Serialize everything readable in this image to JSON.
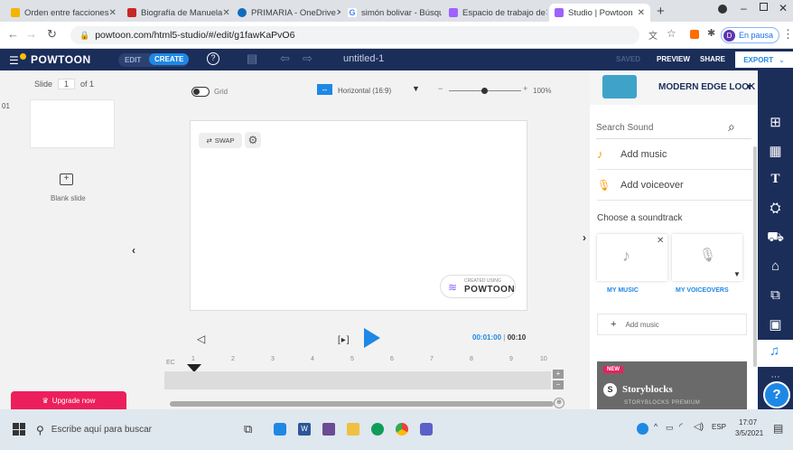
{
  "tabs": [
    {
      "label": "Orden entre facciones",
      "color": "#f4b400"
    },
    {
      "label": "Biografía de Manuela",
      "color": "#c62828"
    },
    {
      "label": "PRIMARIA - OneDrive",
      "color": "#0f6cbd"
    },
    {
      "label": "simón bolivar - Búsqu",
      "color": "#4285f4"
    },
    {
      "label": "Espacio de trabajo de",
      "color": "#a061ff"
    },
    {
      "label": "Studio | Powtoon",
      "color": "#a061ff"
    }
  ],
  "browser": {
    "url": "powtoon.com/html5-studio/#/edit/g1fawKaPvO6",
    "profile_initial": "D",
    "profile_status": "En pausa"
  },
  "toolbar": {
    "logo": "POWTOON",
    "edit": "EDIT",
    "create": "CREATE",
    "doc_title": "untitled-1",
    "saved": "SAVED",
    "preview": "PREVIEW",
    "share": "SHARE",
    "export": "EXPORT"
  },
  "slides": {
    "label": "Slide",
    "current": "1",
    "of": "of 1",
    "number": "01",
    "blank": "Blank slide"
  },
  "canvas": {
    "grid": "Grid",
    "orientation": "Horizontal (16:9)",
    "zoom": "100%",
    "swap": "SWAP",
    "watermark_small": "CREATED USING",
    "watermark": "POWTOON"
  },
  "timeline": {
    "time_current": "00:01:00",
    "time_total": "00:10",
    "ruler_start": "EC",
    "ticks": [
      "1",
      "2",
      "3",
      "4",
      "5",
      "6",
      "7",
      "8",
      "9",
      "10"
    ]
  },
  "upgrade": "Upgrade now",
  "panel": {
    "style_name": "MODERN EDGE LOOK",
    "search_placeholder": "Search Sound",
    "add_music": "Add music",
    "add_voiceover": "Add voiceover",
    "choose": "Choose a soundtrack",
    "my_music": "MY MUSIC",
    "my_voiceovers": "MY VOICEOVERS",
    "add_music_small": "Add music",
    "new_badge": "NEW",
    "storyblocks": "Storyblocks",
    "storyblocks_premium": "STORYBLOCKS PREMIUM"
  },
  "taskbar": {
    "search": "Escribe aquí para buscar",
    "lang": "ESP",
    "time": "17:07",
    "date": "3/5/2021"
  },
  "colors": {
    "navy": "#1b2e5a",
    "accent": "#1e88e5",
    "upgrade": "#ec1f5c",
    "orange": "#ff9800"
  }
}
